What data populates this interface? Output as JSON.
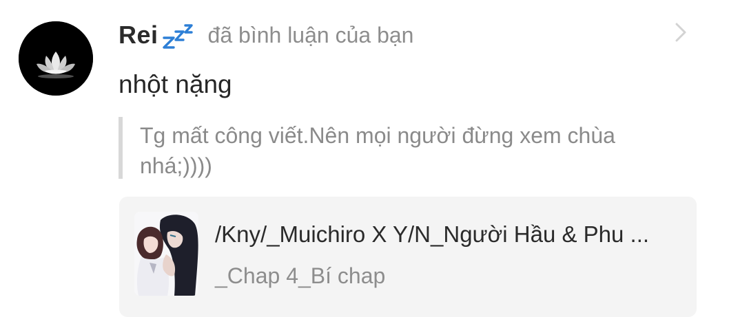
{
  "comment": {
    "username": "Rei",
    "username_badge": "zzz-sleep-emoji",
    "action_text": "đã bình luận của bạn",
    "reply_text": "nhột nặng",
    "quoted_text": "Tg mất công viết.Nên mọi người đừng xem chùa nhá;))))"
  },
  "story": {
    "title": "/Kny/_Muichiro X Y/N_Người Hầu & Phu ...",
    "chapter": "_Chap 4_Bí chap",
    "cover_icon": "anime-couple-cover-image"
  },
  "icons": {
    "avatar": "white-lotus-avatar",
    "chevron": "chevron-right-icon"
  },
  "colors": {
    "username": "#2b2b2b",
    "meta_gray": "#8d8d8d",
    "quote_border": "#d8d8d8",
    "card_background": "#f4f4f4",
    "zzz_blue": "#2d7fd6"
  }
}
